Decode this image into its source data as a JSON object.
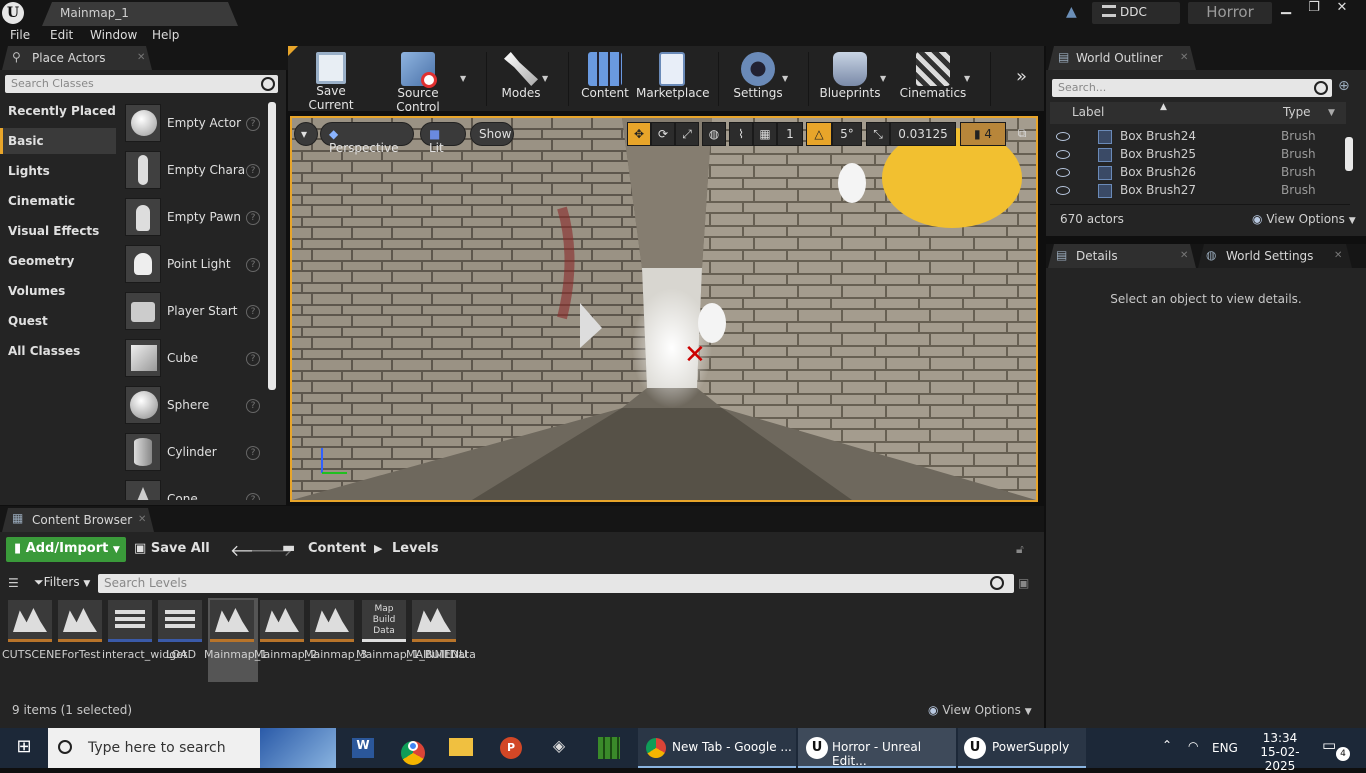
{
  "window": {
    "tab_title": "Mainmap_1",
    "ddc_label": "DDC",
    "project_name": "Horror"
  },
  "menu": [
    "File",
    "Edit",
    "Window",
    "Help"
  ],
  "place_actors": {
    "tab_label": "Place Actors",
    "search_placeholder": "Search Classes",
    "categories": [
      "Recently Placed",
      "Basic",
      "Lights",
      "Cinematic",
      "Visual Effects",
      "Geometry",
      "Volumes",
      "Quest",
      "All Classes"
    ],
    "selected_category": "Basic",
    "actors": [
      "Empty Actor",
      "Empty Chara",
      "Empty Pawn",
      "Point Light",
      "Player Start",
      "Cube",
      "Sphere",
      "Cylinder",
      "Cone"
    ]
  },
  "toolbar": [
    {
      "label": "Save Current",
      "icon": "save-icon",
      "dropdown": false
    },
    {
      "label": "Source Control",
      "icon": "source-control-icon",
      "dropdown": true
    },
    {
      "label": "Modes",
      "icon": "modes-icon",
      "dropdown": true
    },
    {
      "label": "Content",
      "icon": "content-icon",
      "dropdown": false
    },
    {
      "label": "Marketplace",
      "icon": "marketplace-icon",
      "dropdown": false
    },
    {
      "label": "Settings",
      "icon": "settings-icon",
      "dropdown": true
    },
    {
      "label": "Blueprints",
      "icon": "blueprints-icon",
      "dropdown": true
    },
    {
      "label": "Cinematics",
      "icon": "cinematics-icon",
      "dropdown": true
    }
  ],
  "viewport": {
    "view_mode": "Perspective",
    "lighting": "Lit",
    "show": "Show",
    "grid_snap": "1",
    "rotation_snap": "5°",
    "scale_snap": "0.03125",
    "camera_speed": "4"
  },
  "world_outliner": {
    "tab_label": "World Outliner",
    "search_placeholder": "Search...",
    "col_label": "Label",
    "col_type": "Type",
    "rows": [
      {
        "label": "Box Brush24",
        "type": "Brush"
      },
      {
        "label": "Box Brush25",
        "type": "Brush"
      },
      {
        "label": "Box Brush26",
        "type": "Brush"
      },
      {
        "label": "Box Brush27",
        "type": "Brush"
      }
    ],
    "actor_count": "670 actors",
    "view_options": "View Options"
  },
  "details": {
    "tab_label": "Details",
    "world_settings_label": "World Settings",
    "empty_text": "Select an object to view details."
  },
  "content_browser": {
    "tab_label": "Content Browser",
    "add_import": "Add/Import",
    "save_all": "Save All",
    "path": [
      "Content",
      "Levels"
    ],
    "filters": "Filters",
    "search_placeholder": "Search Levels",
    "assets": [
      {
        "name": "CUTSCENE",
        "kind": "level"
      },
      {
        "name": "ForTest",
        "kind": "level"
      },
      {
        "name": "interact_widget",
        "kind": "widget"
      },
      {
        "name": "LOAD",
        "kind": "widget"
      },
      {
        "name": "Mainmap_1",
        "kind": "level"
      },
      {
        "name": "Mainmap_2",
        "kind": "level"
      },
      {
        "name": "Mainmap_3",
        "kind": "level"
      },
      {
        "name": "Mainmap_1_BuiltData",
        "kind": "builtdata",
        "thumb_text": "Map Build Data"
      },
      {
        "name": "MAINMENU",
        "kind": "level"
      }
    ],
    "selected_asset": "Mainmap_1",
    "status": "9 items (1 selected)",
    "view_options": "View Options"
  },
  "taskbar": {
    "search_placeholder": "Type here to search",
    "apps": [
      {
        "label": "New Tab - Google ...",
        "icon": "chrome-icon"
      },
      {
        "label": "Horror - Unreal Edit...",
        "icon": "unreal-icon"
      },
      {
        "label": "PowerSupply",
        "icon": "unreal-icon"
      }
    ],
    "language": "ENG",
    "time": "13:34",
    "date": "15-02-2025",
    "notification_count": "4"
  },
  "colors": {
    "accent": "#e8a52a",
    "add_button": "#3a9a3a",
    "taskbar": "#1c2838"
  }
}
